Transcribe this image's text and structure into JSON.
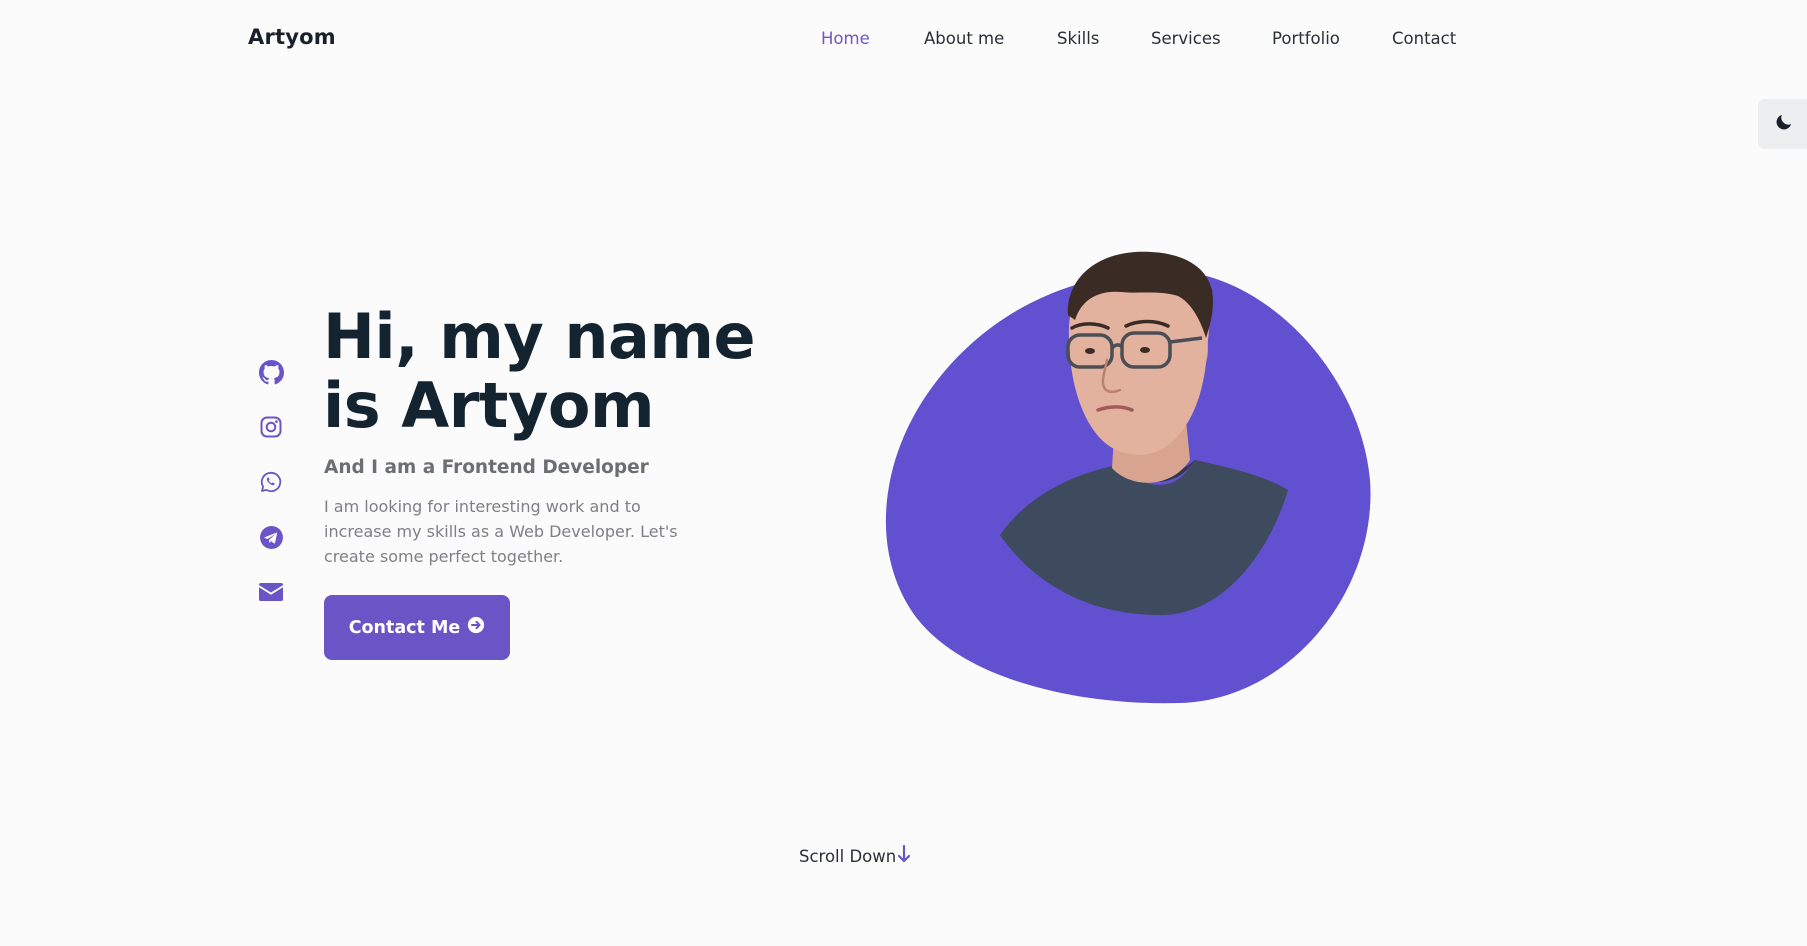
{
  "header": {
    "logo": "Artyom",
    "nav": [
      {
        "label": "Home",
        "active": true
      },
      {
        "label": "About me",
        "active": false
      },
      {
        "label": "Skills",
        "active": false
      },
      {
        "label": "Services",
        "active": false
      },
      {
        "label": "Portfolio",
        "active": false
      },
      {
        "label": "Contact",
        "active": false
      }
    ]
  },
  "theme_toggle": {
    "icon": "moon-icon"
  },
  "social": [
    {
      "icon": "github-icon"
    },
    {
      "icon": "instagram-icon"
    },
    {
      "icon": "whatsapp-icon"
    },
    {
      "icon": "telegram-icon"
    },
    {
      "icon": "email-icon"
    }
  ],
  "hero": {
    "title": "Hi, my name is Artyom",
    "subtitle": "And I am a Frontend Developer",
    "description": "I am looking for interesting work and to increase my skills as a Web Developer. Let's create some perfect together.",
    "button_label": "Contact Me",
    "button_icon": "arrow-circle-right-icon"
  },
  "scroll": {
    "label": "Scroll Down",
    "icon": "arrow-down-icon"
  },
  "colors": {
    "accent": "#6a55c6",
    "blob": "#6150cf",
    "heading": "#142330",
    "background": "#fcfbfb"
  }
}
